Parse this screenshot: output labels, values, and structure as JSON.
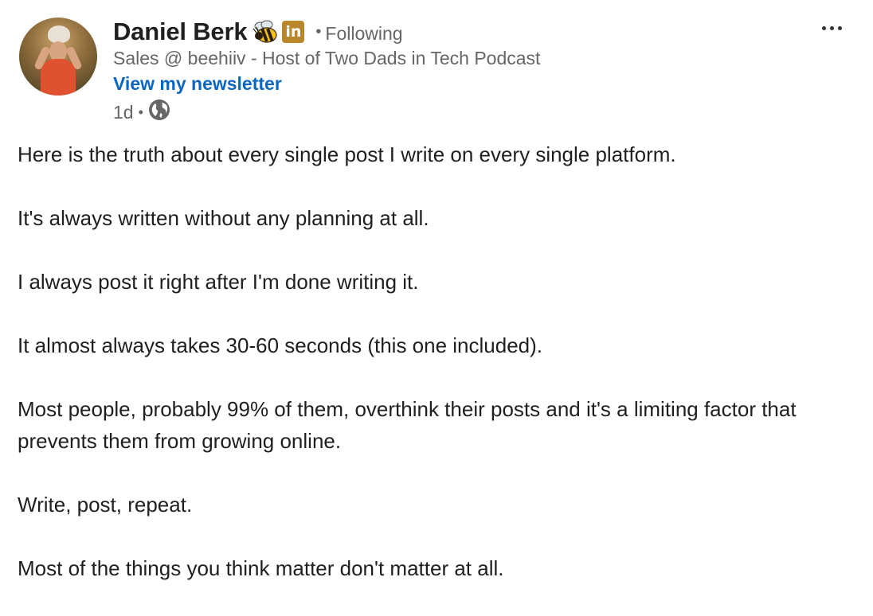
{
  "author": {
    "name": "Daniel Berk",
    "badge_icon": "bee-emoji-icon",
    "network_badge": "in",
    "separator": "•",
    "follow_status": "Following",
    "headline": "Sales @ beehiiv - Host of Two Dads in Tech Podcast",
    "newsletter_link": "View my newsletter"
  },
  "meta": {
    "age": "1d",
    "separator": "•",
    "visibility_icon": "globe-icon"
  },
  "post": {
    "paragraphs": [
      "Here is the truth about every single post I write on every single platform.",
      "It's always written without any planning at all.",
      "I always post it right after I'm done writing it.",
      "It almost always takes 30-60 seconds (this one included).",
      "Most people, probably 99% of them, overthink their posts and it's a limiting factor that prevents them from growing online.",
      "Write, post, repeat.",
      "Most of the things you think matter don't matter at all."
    ]
  },
  "colors": {
    "link": "#0a66c2",
    "muted": "#666666",
    "text": "#1f1f1f",
    "badge": "#b8862b"
  }
}
